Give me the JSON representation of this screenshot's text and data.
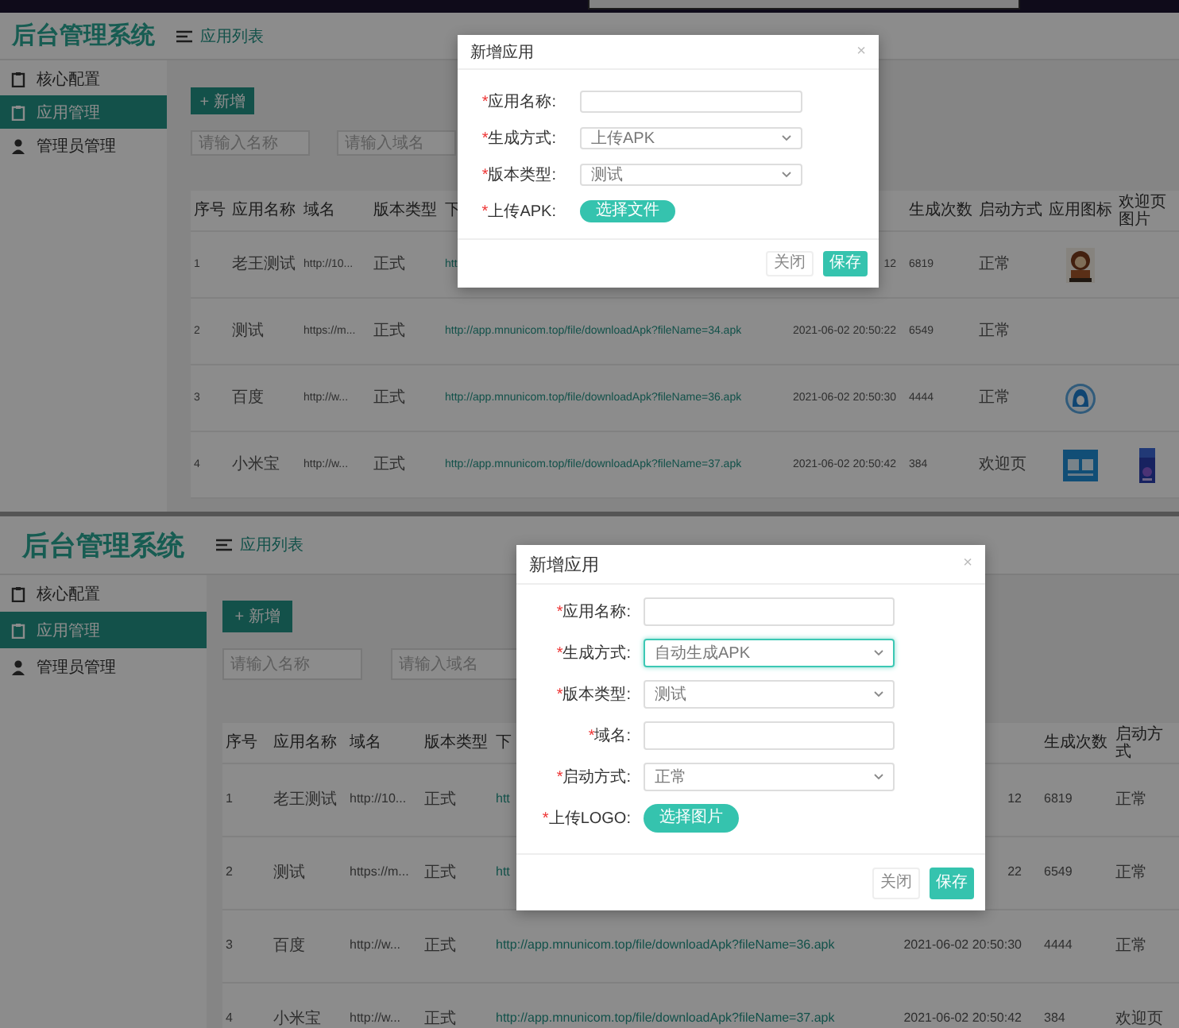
{
  "screens": [
    {
      "brand": "后台管理系统",
      "breadcrumb": "应用列表",
      "sidebar": {
        "items": [
          {
            "label": "核心配置",
            "kind": "clipboard",
            "selected": false
          },
          {
            "label": "应用管理",
            "kind": "clipboard",
            "selected": true
          },
          {
            "label": "管理员管理",
            "kind": "person",
            "selected": false
          }
        ]
      },
      "add_button": "+ 新增",
      "search": [
        {
          "placeholder": "请输入名称"
        },
        {
          "placeholder": "请输入域名"
        }
      ],
      "table": {
        "columns": [
          {
            "label": "序号"
          },
          {
            "label": "应用名称"
          },
          {
            "label": "域名"
          },
          {
            "label": "版本类型"
          },
          {
            "label": "下"
          },
          {},
          {
            "label": "生成次数"
          },
          {
            "label": "启动方式"
          },
          {
            "label": "应用图标"
          },
          {
            "label": "欢迎页图片"
          }
        ],
        "rows": [
          {
            "cells": [
              "1",
              "老王测试",
              "http://10...",
              "正式",
              "htt",
              "12",
              "6819",
              "正常"
            ],
            "icon": {
              "kind": "figure"
            }
          },
          {
            "cells": [
              "2",
              "测试",
              "https://m...",
              "正式",
              "http://app.mnunicom.top/file/downloadApk?fileName=34.apk",
              "2021-06-02 20:50:22",
              "6549",
              "正常"
            ]
          },
          {
            "cells": [
              "3",
              "百度",
              "http://w...",
              "正式",
              "http://app.mnunicom.top/file/downloadApk?fileName=36.apk",
              "2021-06-02 20:50:30",
              "4444",
              "正常"
            ],
            "icon": {
              "kind": "bubble"
            }
          },
          {
            "cells": [
              "4",
              "小米宝",
              "http://w...",
              "正式",
              "http://app.mnunicom.top/file/downloadApk?fileName=37.apk",
              "2021-06-02 20:50:42",
              "384",
              "欢迎页"
            ],
            "icon": {
              "kind": "tile"
            }
          }
        ]
      },
      "dialog": {
        "title": "新增应用",
        "close": "×",
        "fields": [
          {
            "kind": "input",
            "mark": "*",
            "label": "应用名称:",
            "focused": false
          },
          {
            "kind": "select",
            "mark": "*",
            "label": "生成方式:",
            "value": "上传APK",
            "focused": false
          },
          {
            "kind": "select",
            "mark": "*",
            "label": "版本类型:",
            "value": "测试",
            "focused": false
          },
          {
            "kind": "upload",
            "mark": "*",
            "label": "上传APK:",
            "button": "选择文件"
          }
        ],
        "buttons": [
          {
            "label": "关闭",
            "kind": "plain"
          },
          {
            "label": "保存",
            "kind": "primary"
          }
        ]
      }
    },
    {
      "brand": "后台管理系统",
      "breadcrumb": "应用列表",
      "sidebar": {
        "items": [
          {
            "label": "核心配置",
            "kind": "clipboard",
            "selected": false
          },
          {
            "label": "应用管理",
            "kind": "clipboard",
            "selected": true
          },
          {
            "label": "管理员管理",
            "kind": "person",
            "selected": false
          }
        ]
      },
      "add_button": "+ 新增",
      "search": [
        {
          "placeholder": "请输入名称"
        },
        {
          "placeholder": "请输入域名"
        }
      ],
      "table": {
        "columns": [
          {
            "label": "序号"
          },
          {
            "label": "应用名称"
          },
          {
            "label": "域名"
          },
          {
            "label": "版本类型"
          },
          {
            "label": "下"
          },
          {},
          {
            "label": "生成次数"
          },
          {
            "label": "启动方式"
          }
        ],
        "rows": [
          {
            "cells": [
              "1",
              "老王测试",
              "http://10...",
              "正式",
              "htt",
              "12",
              "6819",
              "正常"
            ]
          },
          {
            "cells": [
              "2",
              "测试",
              "https://m...",
              "正式",
              "htt",
              "22",
              "6549",
              "正常"
            ]
          },
          {
            "cells": [
              "3",
              "百度",
              "http://w...",
              "正式",
              "http://app.mnunicom.top/file/downloadApk?fileName=36.apk",
              "2021-06-02 20:50:30",
              "4444",
              "正常"
            ]
          },
          {
            "cells": [
              "4",
              "小米宝",
              "http://w...",
              "正式",
              "http://app.mnunicom.top/file/downloadApk?fileName=37.apk",
              "2021-06-02 20:50:42",
              "384",
              "欢迎页"
            ]
          }
        ]
      },
      "dialog": {
        "title": "新增应用",
        "close": "×",
        "fields": [
          {
            "kind": "input",
            "mark": "*",
            "label": "应用名称:",
            "focused": false
          },
          {
            "kind": "select",
            "mark": "*",
            "label": "生成方式:",
            "value": "自动生成APK",
            "focused": true
          },
          {
            "kind": "select",
            "mark": "*",
            "label": "版本类型:",
            "value": "测试",
            "focused": false
          },
          {
            "kind": "input",
            "mark": "*",
            "label": "域名:",
            "focused": false
          },
          {
            "kind": "select",
            "mark": "*",
            "label": "启动方式:",
            "value": "正常",
            "focused": false
          },
          {
            "kind": "upload",
            "mark": "*",
            "label": "上传LOGO:",
            "button": "选择图片"
          }
        ],
        "buttons": [
          {
            "label": "关闭",
            "kind": "plain"
          },
          {
            "label": "保存",
            "kind": "primary"
          }
        ]
      }
    }
  ]
}
